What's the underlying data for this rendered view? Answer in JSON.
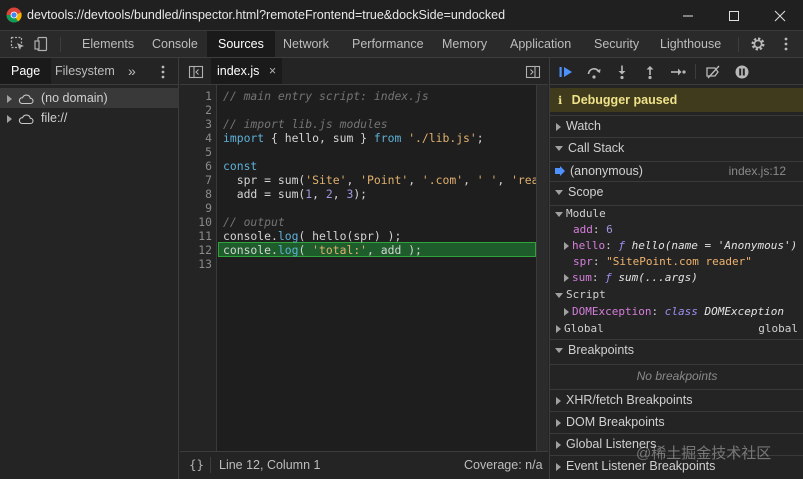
{
  "window": {
    "title": "devtools://devtools/bundled/inspector.html?remoteFrontend=true&dockSide=undocked",
    "minimize": "—",
    "maximize": "☐",
    "close": "✕"
  },
  "toolbar": {
    "tabs": [
      "Elements",
      "Console",
      "Sources",
      "Network",
      "Performance",
      "Memory",
      "Application",
      "Security",
      "Lighthouse"
    ],
    "active_tab": "Sources"
  },
  "navigator": {
    "tabs": [
      "Page",
      "Filesystem"
    ],
    "more": "»",
    "items": [
      "(no domain)",
      "file://"
    ]
  },
  "editor": {
    "file_tab": "index.js",
    "close_glyph": "×",
    "highlighted_line": 12,
    "lines": [
      {
        "n": "1",
        "parts": [
          {
            "t": "// main entry script: index.js",
            "c": "com"
          }
        ]
      },
      {
        "n": "2",
        "parts": []
      },
      {
        "n": "3",
        "parts": [
          {
            "t": "// import lib.js modules",
            "c": "com"
          }
        ]
      },
      {
        "n": "4",
        "parts": [
          {
            "t": "import",
            "c": "kw"
          },
          {
            "t": " { hello, sum } ",
            "c": ""
          },
          {
            "t": "from",
            "c": "kw"
          },
          {
            "t": " ",
            "c": ""
          },
          {
            "t": "'./lib.js'",
            "c": "str"
          },
          {
            "t": ";",
            "c": ""
          }
        ]
      },
      {
        "n": "5",
        "parts": []
      },
      {
        "n": "6",
        "parts": [
          {
            "t": "const",
            "c": "kw"
          }
        ]
      },
      {
        "n": "7",
        "parts": [
          {
            "t": "  spr = sum(",
            "c": ""
          },
          {
            "t": "'Site'",
            "c": "str"
          },
          {
            "t": ", ",
            "c": ""
          },
          {
            "t": "'Point'",
            "c": "str"
          },
          {
            "t": ", ",
            "c": ""
          },
          {
            "t": "'.com'",
            "c": "str"
          },
          {
            "t": ", ",
            "c": ""
          },
          {
            "t": "' '",
            "c": "str"
          },
          {
            "t": ", ",
            "c": ""
          },
          {
            "t": "'reader'",
            "c": "str"
          }
        ]
      },
      {
        "n": "8",
        "parts": [
          {
            "t": "  add = sum(",
            "c": ""
          },
          {
            "t": "1",
            "c": "num"
          },
          {
            "t": ", ",
            "c": ""
          },
          {
            "t": "2",
            "c": "num"
          },
          {
            "t": ", ",
            "c": ""
          },
          {
            "t": "3",
            "c": "num"
          },
          {
            "t": ");",
            "c": ""
          }
        ]
      },
      {
        "n": "9",
        "parts": []
      },
      {
        "n": "10",
        "parts": [
          {
            "t": "// output",
            "c": "com"
          }
        ]
      },
      {
        "n": "11",
        "parts": [
          {
            "t": "console.",
            "c": ""
          },
          {
            "t": "log",
            "c": "kw"
          },
          {
            "t": "( hello(spr) );",
            "c": ""
          }
        ]
      },
      {
        "n": "12",
        "parts": [
          {
            "t": "console.",
            "c": ""
          },
          {
            "t": "log",
            "c": "kw"
          },
          {
            "t": "( ",
            "c": ""
          },
          {
            "t": "'total:'",
            "c": "str"
          },
          {
            "t": ", add );",
            "c": ""
          }
        ]
      },
      {
        "n": "13",
        "parts": []
      }
    ]
  },
  "status": {
    "braces": "{}",
    "position": "Line 12, Column 1",
    "coverage": "Coverage: n/a"
  },
  "debugger": {
    "paused": "Debugger paused",
    "watch": "Watch",
    "call_stack": "Call Stack",
    "frame_name": "(anonymous)",
    "frame_location": "index.js:12",
    "scope": "Scope",
    "module": "Module",
    "vars": {
      "add_key": "add",
      "add_val": "6",
      "hello_key": "hello",
      "hello_f": "ƒ",
      "hello_sig": "hello(name = 'Anonymous')",
      "spr_key": "spr",
      "spr_val": "\"SitePoint.com reader\"",
      "sum_key": "sum",
      "sum_f": "ƒ",
      "sum_sig": "sum(...args)"
    },
    "script": "Script",
    "dom_exception_key": "DOMException",
    "dom_exception_kw": "class",
    "dom_exception_val": "DOMException",
    "global": "Global",
    "global_val": "global",
    "breakpoints": "Breakpoints",
    "no_breakpoints": "No breakpoints",
    "xhr": "XHR/fetch Breakpoints",
    "dom_bp": "DOM Breakpoints",
    "global_listeners": "Global Listeners",
    "event_listener": "Event Listener Breakpoints"
  },
  "watermark": "@稀土掘金技术社区",
  "colors": {
    "accent_paused": "#efe28a",
    "highlight_line": "#1e5c2c",
    "highlight_border": "#31a33c"
  }
}
